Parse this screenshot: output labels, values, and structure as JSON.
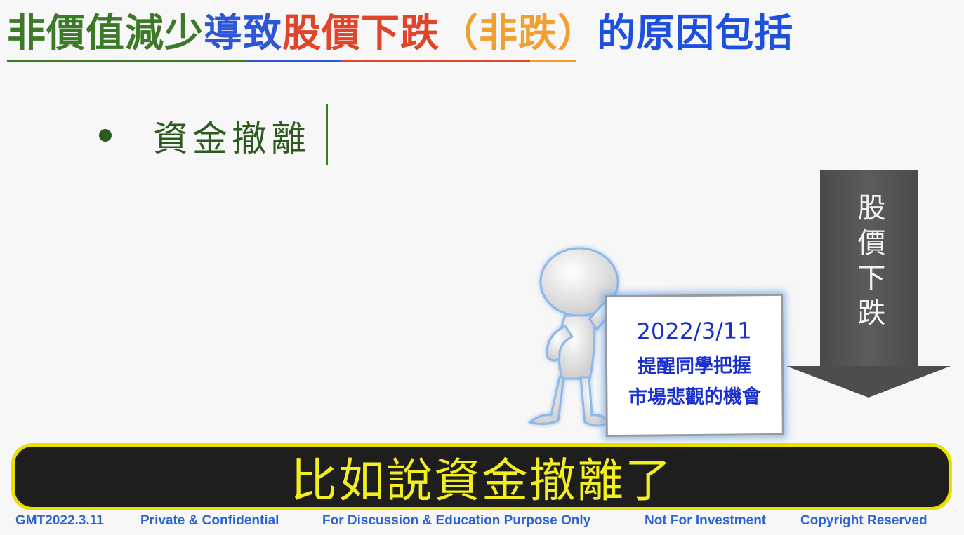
{
  "title": {
    "part1": "非價值減少",
    "part2": "導致",
    "part3": "股價下跌",
    "part4": "（非跌）",
    "part5": "的原因包括"
  },
  "bullet": {
    "text": "資金撤離"
  },
  "arrow": {
    "label": "股價下跌"
  },
  "sign": {
    "date": "2022/3/11",
    "line1": "提醒同學把握",
    "line2": "市場悲觀的機會"
  },
  "subtitle": {
    "text": "比如說資金撤離了"
  },
  "footer": {
    "code": "GMT2022.3.11",
    "private": "Private & Confidential",
    "purpose": "For Discussion & Education Purpose Only",
    "investment": "Not For Investment",
    "copyright": "Copyright Reserved"
  },
  "colors": {
    "green": "#3c7a2a",
    "blue": "#2f56d6",
    "red": "#e0452b",
    "orange": "#f0a030",
    "subtitle_yellow": "#f2ee20"
  }
}
